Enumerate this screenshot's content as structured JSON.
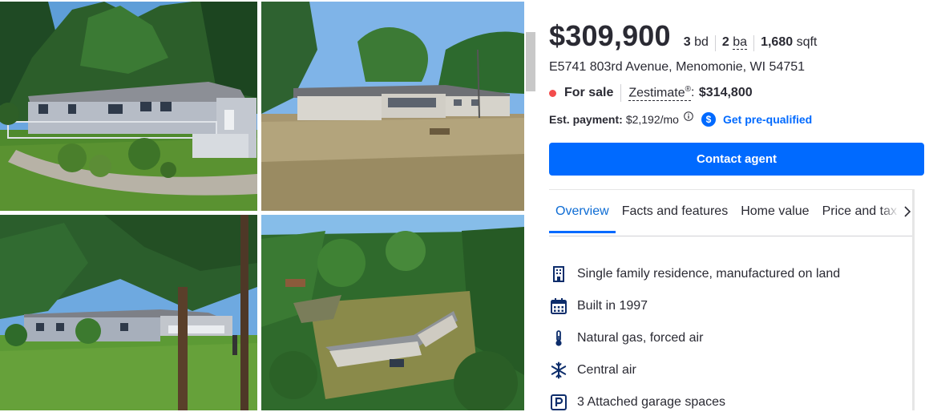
{
  "listing": {
    "price": "$309,900",
    "beds_value": "3",
    "beds_unit": "bd",
    "baths_value": "2",
    "baths_unit": "ba",
    "sqft_value": "1,680",
    "sqft_unit": "sqft",
    "address": "E5741 803rd Avenue, Menomonie, WI 54751",
    "status": "For sale",
    "zestimate_label": "Zestimate",
    "zestimate_mark": "®",
    "zestimate_value": "$314,800",
    "payment_label": "Est. payment:",
    "payment_value": "$2,192/mo",
    "prequal_badge": "$",
    "prequal_link": "Get pre-qualified",
    "contact_button": "Contact agent"
  },
  "tabs": [
    {
      "label": "Overview",
      "active": true
    },
    {
      "label": "Facts and features",
      "active": false
    },
    {
      "label": "Home value",
      "active": false
    },
    {
      "label": "Price and tax h",
      "active": false
    }
  ],
  "features": [
    {
      "icon": "building-icon",
      "text": "Single family residence, manufactured on land"
    },
    {
      "icon": "calendar-icon",
      "text": "Built in 1997"
    },
    {
      "icon": "thermometer-icon",
      "text": "Natural gas, forced air"
    },
    {
      "icon": "snowflake-icon",
      "text": "Central air"
    },
    {
      "icon": "parking-icon",
      "text": "3 Attached garage spaces"
    }
  ],
  "colors": {
    "accent": "#006aff",
    "status_dot": "#f34c4c",
    "text": "#2a2a33"
  }
}
